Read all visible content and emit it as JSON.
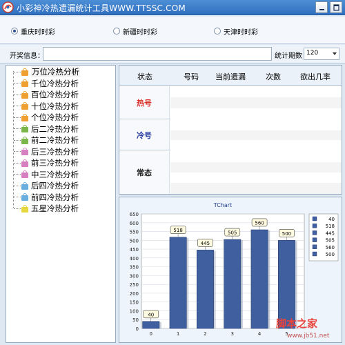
{
  "window": {
    "title": "小彩神冷热遗漏统计工具WWW.TTSSC.COM"
  },
  "lottery_options": [
    {
      "label": "重庆时时彩",
      "selected": true
    },
    {
      "label": "新疆时时彩",
      "selected": false
    },
    {
      "label": "天津时时彩",
      "selected": false
    }
  ],
  "info": {
    "label": "开奖信息：",
    "value": "",
    "period_label": "统计期数",
    "period_value": "120"
  },
  "tree": {
    "items": [
      {
        "label": "万位冷热分析",
        "color": "#f0a030",
        "selected": true
      },
      {
        "label": "千位冷热分析",
        "color": "#f0a030"
      },
      {
        "label": "百位冷热分析",
        "color": "#f0a030"
      },
      {
        "label": "十位冷热分析",
        "color": "#f0a030"
      },
      {
        "label": "个位冷热分析",
        "color": "#f0a030"
      },
      {
        "label": "后二冷热分析",
        "color": "#7ab648"
      },
      {
        "label": "前二冷热分析",
        "color": "#7ab648"
      },
      {
        "label": "后三冷热分析",
        "color": "#d77fc0"
      },
      {
        "label": "前三冷热分析",
        "color": "#d77fc0"
      },
      {
        "label": "中三冷热分析",
        "color": "#d77fc0"
      },
      {
        "label": "后四冷热分析",
        "color": "#6aaee0"
      },
      {
        "label": "前四冷热分析",
        "color": "#6aaee0"
      },
      {
        "label": "五星冷热分析",
        "color": "#e8d840"
      }
    ]
  },
  "table": {
    "headers": [
      "状态",
      "号码",
      "当前遗漏",
      "次数",
      "欲出几率"
    ],
    "rows": [
      {
        "label": "热号",
        "color": "#d9312a"
      },
      {
        "label": "冷号",
        "color": "#2a3da0"
      },
      {
        "label": "常态",
        "color": "#222222"
      }
    ]
  },
  "chart_data": {
    "type": "bar",
    "title": "TChart",
    "categories": [
      "0",
      "1",
      "2",
      "3",
      "4",
      "5"
    ],
    "values": [
      40,
      518,
      445,
      505,
      560,
      500
    ],
    "ylim": [
      0,
      650
    ],
    "yticks": [
      0,
      50,
      100,
      150,
      200,
      250,
      300,
      350,
      400,
      450,
      500,
      550,
      600,
      650
    ],
    "legend": [
      "40",
      "518",
      "445",
      "505",
      "560",
      "500"
    ],
    "legend_position": "right",
    "bar_color": "#3f5f9e",
    "grid": true
  },
  "watermark": {
    "text": "脚本之家",
    "url": "www.jb51.net"
  }
}
